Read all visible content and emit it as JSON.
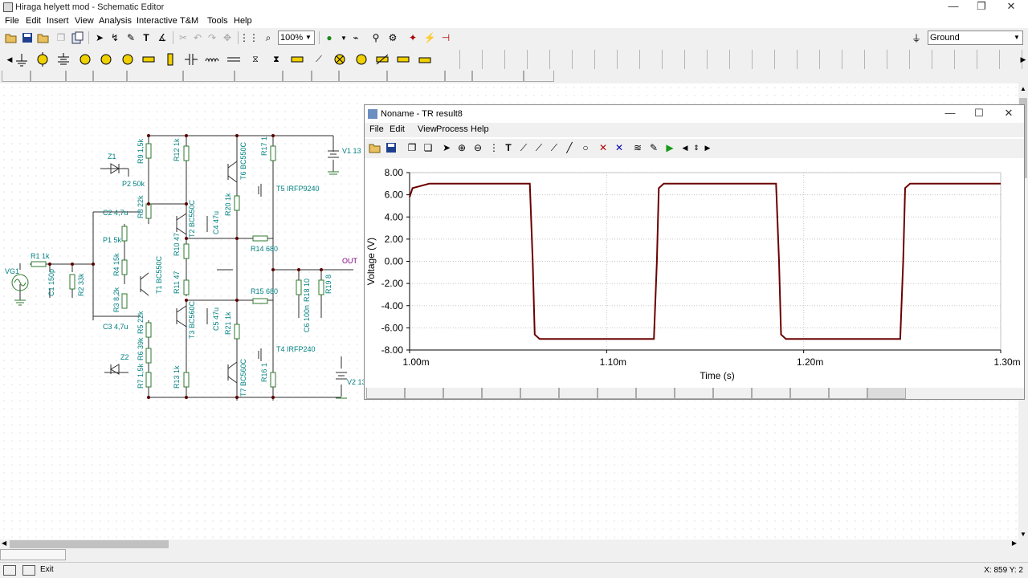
{
  "window": {
    "title": "Hiraga helyett mod - Schematic Editor",
    "minimize": "—",
    "maximize": "❐",
    "close": "✕"
  },
  "menu": [
    "File",
    "Edit",
    "Insert",
    "View",
    "Analysis",
    "Interactive",
    "T&M",
    "Tools",
    "Help"
  ],
  "toolbar": {
    "zoom_value": "100%",
    "ground_value": "Ground"
  },
  "schematic": {
    "labels": {
      "vg1": "VG1",
      "r1": "R1 1k",
      "c1": "C1 150p",
      "r2": "R2 33k",
      "c2": "C2 4,7u",
      "c3": "C3 4,7u",
      "p1": "P1 5k",
      "p2": "P2 50k",
      "z1": "Z1",
      "z2": "Z2",
      "r9": "R9 1,5k",
      "r8": "R8 22k",
      "r4": "R4 15k",
      "r3": "R3 8,2k",
      "r5": "R5 22k",
      "r6": "R6 39k",
      "r7": "R7 1,5k",
      "t1": "T1 BC550C",
      "t2": "T2 BC550C",
      "t3": "T3 BC560C",
      "r12": "R12 1k",
      "r13": "R13 1k",
      "r10": "R10 47",
      "r11": "R11 47",
      "c4": "C4 47u",
      "c5": "C5 47u",
      "t6": "T6 BC550C",
      "t7": "T7 BC560C",
      "r20": "R20 1k",
      "r21": "R21 1k",
      "r14": "R14 680",
      "r15": "R15 680",
      "t5": "T5 IRFP9240",
      "t4": "T4 IRFP240",
      "r17": "R17 1",
      "r16": "R16 1",
      "v1": "V1 13",
      "v2": "V2 13",
      "r18": "R18 10",
      "c6": "C6 100n",
      "r19": "R19 8",
      "out": "OUT"
    }
  },
  "result_window": {
    "title": "Noname - TR result8",
    "menu": [
      "File",
      "Edit",
      "View",
      "Process",
      "Help"
    ],
    "minimize": "—",
    "maximize": "☐",
    "close": "✕"
  },
  "chart_data": {
    "type": "line",
    "title": "",
    "xlabel": "Time (s)",
    "ylabel": "Voltage (V)",
    "xlim": [
      0.001,
      0.0013
    ],
    "ylim": [
      -8,
      8
    ],
    "x_ticks": [
      "1.00m",
      "1.10m",
      "1.20m",
      "1.30m"
    ],
    "y_ticks": [
      "8.00",
      "6.00",
      "4.00",
      "2.00",
      "0.00",
      "-2.00",
      "-4.00",
      "-6.00",
      "-8.00"
    ],
    "grid": true,
    "series": [
      {
        "color": "#6b0000",
        "x": [
          0.001,
          0.0010015,
          0.00101,
          0.001061,
          0.0010625,
          0.0010635,
          0.001066,
          0.001124,
          0.0011255,
          0.0011265,
          0.001129,
          0.001186,
          0.0011875,
          0.0011885,
          0.001191,
          0.001249,
          0.0012505,
          0.0012515,
          0.001254,
          0.0013
        ],
        "y": [
          5.8,
          6.6,
          7.0,
          7.0,
          0.0,
          -6.6,
          -7.0,
          -7.0,
          0.0,
          6.6,
          7.0,
          7.0,
          0.0,
          -6.6,
          -7.0,
          -7.0,
          0.0,
          6.6,
          7.0,
          7.0
        ]
      }
    ]
  },
  "statusbar": {
    "coords": "X: 859 Y: 2",
    "exit": "Exit"
  }
}
